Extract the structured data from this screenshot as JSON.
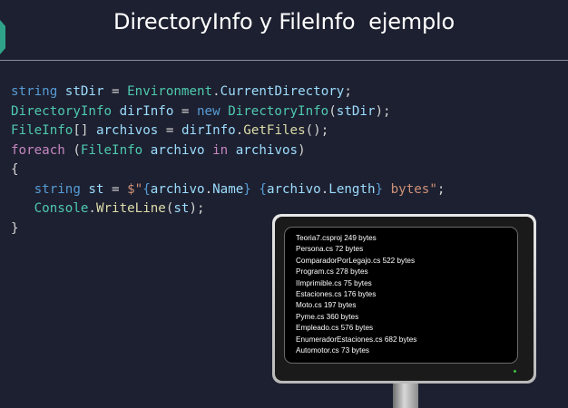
{
  "slide": {
    "title": "DirectoryInfo y FileInfo  ejemplo"
  },
  "code": {
    "line1": {
      "kw_string": "string",
      "sp1": " ",
      "var_stDir": "stDir",
      "eq": " = ",
      "type_env": "Environment",
      "dot": ".",
      "prop_cd": "CurrentDirectory",
      "end": ";"
    },
    "line2": {
      "type_dirinfo": "DirectoryInfo",
      "sp1": " ",
      "var_dirInfo": "dirInfo",
      "eq": " = ",
      "kw_new": "new",
      "sp2": " ",
      "type_dirinfo2": "DirectoryInfo",
      "open": "(",
      "var_stDir": "stDir",
      "close": ");"
    },
    "line3": {
      "type_fileinfo": "FileInfo",
      "brackets": "[] ",
      "var_archivos": "archivos",
      "eq": " = ",
      "var_dirInfo": "dirInfo",
      "dot": ".",
      "fn_getfiles": "GetFiles",
      "close": "();"
    },
    "line4": {
      "kw_foreach": "foreach",
      "open": " (",
      "type_fileinfo": "FileInfo",
      "sp1": " ",
      "var_archivo": "archivo",
      "sp2": " ",
      "kw_in": "in",
      "sp3": " ",
      "var_archivos": "archivos",
      "close": ")"
    },
    "line5": {
      "brace": "{"
    },
    "line6": {
      "indent": "   ",
      "kw_string": "string",
      "sp1": " ",
      "var_st": "st",
      "eq": " = ",
      "str_open": "$\"",
      "brace1": "{",
      "var_archivo1": "archivo",
      "dot1": ".",
      "var_name": "Name",
      "brace2": "}",
      "str_space": " ",
      "brace3": "{",
      "var_archivo2": "archivo",
      "dot2": ".",
      "var_length": "Length",
      "brace4": "}",
      "str_bytes": " bytes\"",
      "end": ";"
    },
    "line7": {
      "indent": "   ",
      "type_console": "Console",
      "dot": ".",
      "fn_writeline": "WriteLine",
      "open": "(",
      "var_st": "st",
      "close": ");"
    },
    "line8": {
      "brace": "}"
    }
  },
  "console_output": {
    "lines": [
      "Teoria7.csproj 249 bytes",
      "Persona.cs 72 bytes",
      "ComparadorPorLegajo.cs 522 bytes",
      "Program.cs 278 bytes",
      "IImprimible.cs 75 bytes",
      "Estaciones.cs 176 bytes",
      "Moto.cs 197 bytes",
      "Pyme.cs 360 bytes",
      "Empleado.cs 576 bytes",
      "EnumeradorEstaciones.cs 682 bytes",
      "Automotor.cs 73 bytes"
    ]
  },
  "colors": {
    "background": "#1d2030",
    "accent": "#2fa38a",
    "keyword": "#569cd6",
    "type": "#4ec9b0",
    "variable": "#9cdcfe",
    "method": "#dcdcaa",
    "string": "#ce9178",
    "control": "#c586c0"
  }
}
